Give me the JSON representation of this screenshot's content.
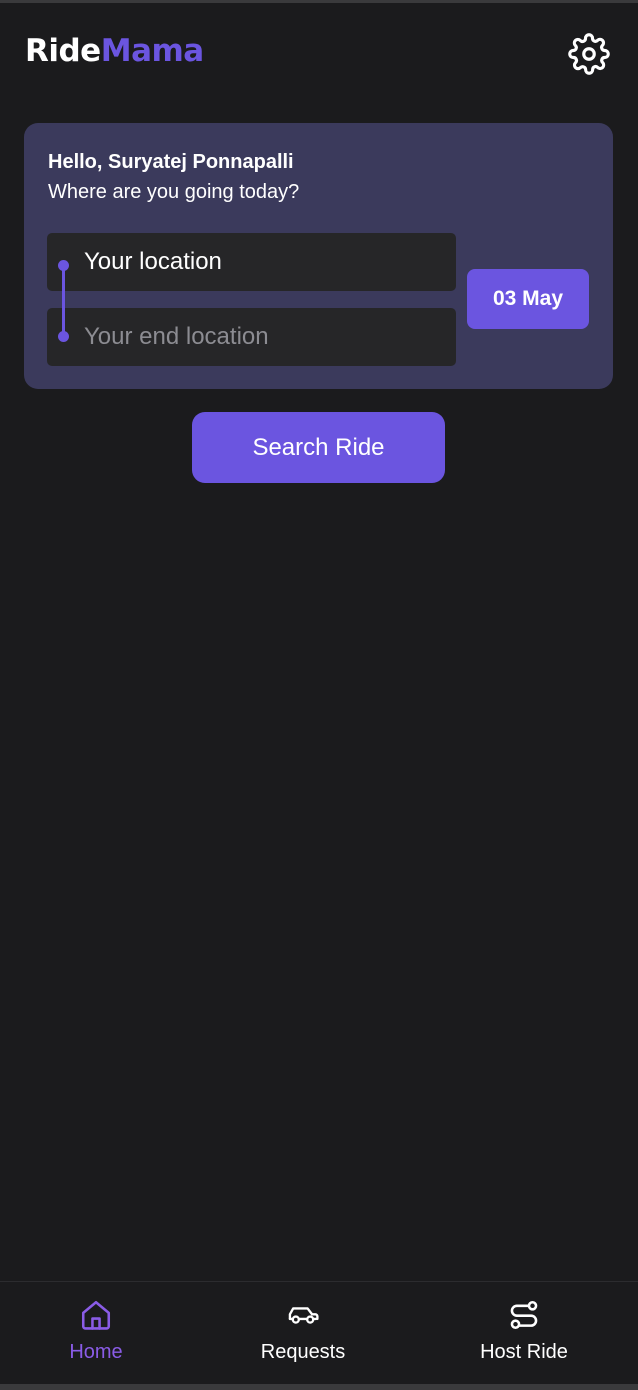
{
  "app": {
    "logo_part1": "Ride",
    "logo_part2": "Mama",
    "accent_color": "#6b55e0"
  },
  "header": {
    "settings_icon": "gear-icon"
  },
  "search_card": {
    "greeting": "Hello, Suryatej Ponnapalli",
    "question": "Where are you going today?",
    "start_placeholder": "Your location",
    "end_placeholder": "Your end location",
    "date_label": "03 May"
  },
  "search_button": {
    "label": "Search Ride"
  },
  "bottom_nav": {
    "items": [
      {
        "label": "Home",
        "icon": "home-icon",
        "active": true
      },
      {
        "label": "Requests",
        "icon": "car-icon",
        "active": false
      },
      {
        "label": "Host Ride",
        "icon": "route-icon",
        "active": false
      }
    ]
  }
}
